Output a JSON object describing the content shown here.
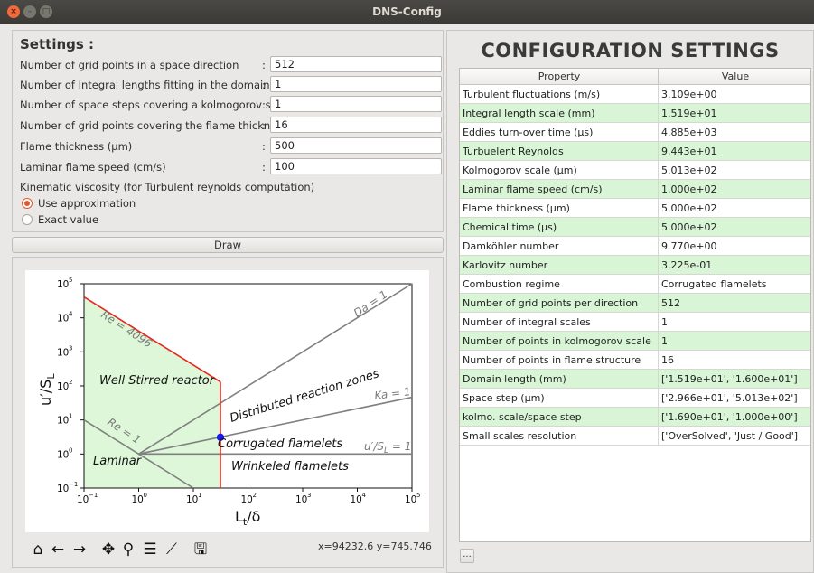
{
  "window": {
    "title": "DNS-Config",
    "close_glyph": "×",
    "min_glyph": "–",
    "max_glyph": "□"
  },
  "settings": {
    "title": "Settings :",
    "fields": [
      {
        "label": "Number of grid points  in a space direction",
        "value": "512"
      },
      {
        "label": "Number of Integral lengths  fitting in the domain",
        "value": "1"
      },
      {
        "label": "Number of space steps covering a kolmogorov scale",
        "value": "1"
      },
      {
        "label": "Number of grid points covering the flame thickness",
        "value": "16"
      },
      {
        "label": "Flame thickness  (µm)",
        "value": "500"
      },
      {
        "label": "Laminar flame speed (cm/s)",
        "value": "100"
      }
    ],
    "colon": ":",
    "viscosity_label": "Kinematic viscosity (for Turbulent reynolds computation)",
    "radio_approx": "Use approximation",
    "radio_exact": "Exact value",
    "selected": "Use approximation"
  },
  "draw_button": "Draw",
  "plot": {
    "chart_data": {
      "type": "line",
      "xlabel": "Lt/δ",
      "ylabel": "u′/SL",
      "xscale": "log",
      "yscale": "log",
      "xlim": [
        0.1,
        100000
      ],
      "ylim": [
        0.1,
        100000
      ],
      "x_ticks": [
        "10",
        "10",
        "10",
        "10",
        "10",
        "10",
        "10"
      ],
      "x_tick_exps": [
        "−1",
        "0",
        "1",
        "2",
        "3",
        "4",
        "5"
      ],
      "y_ticks": [
        "10",
        "10",
        "10",
        "10",
        "10",
        "10",
        "10"
      ],
      "y_tick_exps": [
        "−1",
        "0",
        "1",
        "2",
        "3",
        "4",
        "5"
      ],
      "lines": [
        {
          "name": "Re = 4096",
          "color": "#e8261d",
          "points": [
            [
              0.1,
              40960
            ],
            [
              31.3,
              131
            ]
          ]
        },
        {
          "name": "Re = 1",
          "color": "#808080",
          "points": [
            [
              0.1,
              10
            ],
            [
              10,
              0.1
            ]
          ]
        },
        {
          "name": "Da = 1",
          "color": "#808080",
          "points": [
            [
              1,
              1
            ],
            [
              100000,
              100000
            ]
          ]
        },
        {
          "name": "Ka = 1",
          "color": "#808080",
          "points": [
            [
              1,
              1
            ],
            [
              100000,
              46.4
            ]
          ]
        },
        {
          "name": "u′/SL = 1",
          "color": "#808080",
          "points": [
            [
              1,
              1
            ],
            [
              100000,
              1
            ]
          ]
        },
        {
          "name": "flame",
          "color": "#e8261d",
          "points": [
            [
              31.3,
              0.1
            ],
            [
              31.3,
              131
            ]
          ]
        }
      ],
      "point": {
        "x": 31.3,
        "y": 3.1,
        "color": "#1a1aee"
      },
      "regions": [
        "Well Stirred  reactor",
        "Distributed reaction  zones",
        "Corrugated  flamelets",
        "Wrinkeled  flamelets",
        "Laminar"
      ],
      "line_labels": [
        "Re = 4096",
        "Re = 1",
        "Da = 1",
        "Ka = 1",
        "u′/S",
        "L",
        " = 1"
      ],
      "axis_label_parts": {
        "y_main": "u′/S",
        "y_sub": "L",
        "x_main": "L",
        "x_sub": "t",
        "x_tail": "/δ"
      }
    }
  },
  "toolbar": {
    "icons": [
      "home-icon",
      "back-arrow-icon",
      "forward-arrow-icon",
      "pan-icon",
      "zoom-icon",
      "subplots-icon",
      "edit-axes-icon",
      "save-icon"
    ],
    "glyphs": [
      "⌂",
      "←",
      "→",
      "✥",
      "⚲",
      "☰",
      "⟋",
      "🖫"
    ]
  },
  "coords": "x=94232.6    y=745.746",
  "config": {
    "title": "CONFIGURATION  SETTINGS",
    "col_property": "Property",
    "col_value": "Value",
    "rows": [
      {
        "p": "Turbulent fluctuations (m/s)",
        "v": "3.109e+00"
      },
      {
        "p": "Integral length scale (mm)",
        "v": "1.519e+01"
      },
      {
        "p": "Eddies turn-over time (µs)",
        "v": "4.885e+03"
      },
      {
        "p": "Turbuelent Reynolds",
        "v": "9.443e+01"
      },
      {
        "p": "Kolmogorov scale (µm)",
        "v": "5.013e+02"
      },
      {
        "p": "Laminar flame speed (cm/s)",
        "v": "1.000e+02"
      },
      {
        "p": "Flame thickness (µm)",
        "v": "5.000e+02"
      },
      {
        "p": "Chemical time (µs)",
        "v": "5.000e+02"
      },
      {
        "p": "Damköhler number",
        "v": "9.770e+00"
      },
      {
        "p": "Karlovitz number",
        "v": "3.225e-01"
      },
      {
        "p": "Combustion regime",
        "v": "Corrugated flamelets"
      },
      {
        "p": "Number of grid points per direction",
        "v": "512"
      },
      {
        "p": "Number of integral scales",
        "v": "1"
      },
      {
        "p": "Number of points in kolmogorov scale",
        "v": "1"
      },
      {
        "p": "Number of points in flame structure",
        "v": "16"
      },
      {
        "p": "Domain length (mm)",
        "v": "['1.519e+01', '1.600e+01']"
      },
      {
        "p": "Space step (µm)",
        "v": "['2.966e+01', '5.013e+02']"
      },
      {
        "p": "kolmo. scale/space step",
        "v": "['1.690e+01', '1.000e+00']"
      },
      {
        "p": "Small scales resolution",
        "v": "['OverSolved', 'Just / Good']"
      }
    ],
    "more_button": "..."
  }
}
